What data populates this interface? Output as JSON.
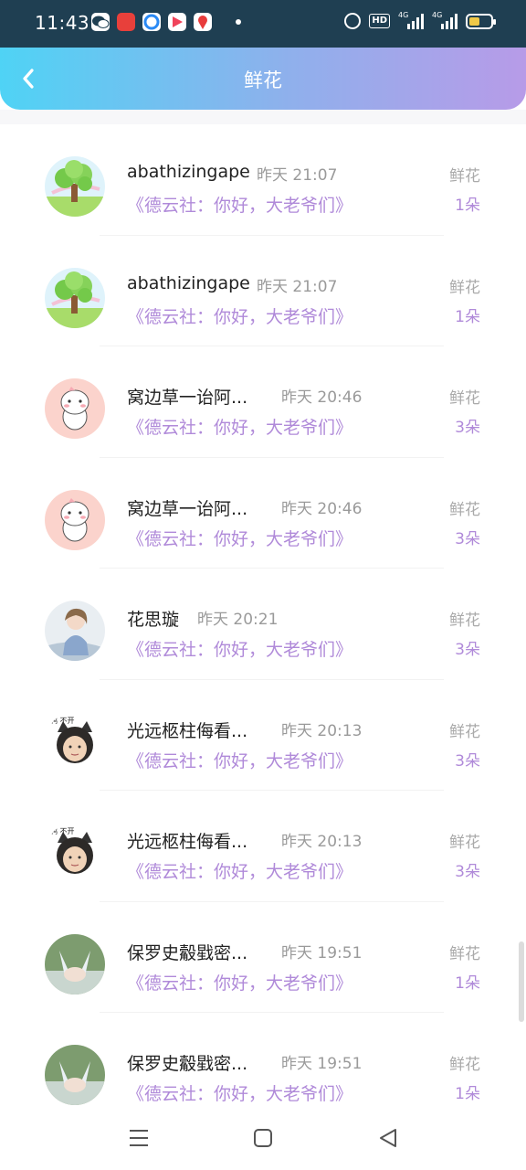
{
  "status_bar": {
    "time": "11:43",
    "network_a": "4G",
    "network_b": "4G",
    "hd": "HD",
    "app_icons": [
      "wechat-icon",
      "toutiao-icon",
      "browser-icon",
      "video-icon",
      "map-icon"
    ]
  },
  "header": {
    "title": "鲜花",
    "back_icon": "chevron-left-icon"
  },
  "rows": [
    {
      "name": "abathizingape",
      "time": "昨天 21:07",
      "program": "《德云社：你好，大老爷们》",
      "gift": "鲜花",
      "count": "1朵",
      "avatar": "tree-avatar"
    },
    {
      "name": "abathizingape",
      "time": "昨天 21:07",
      "program": "《德云社：你好，大老爷们》",
      "gift": "鲜花",
      "count": "1朵",
      "avatar": "tree-avatar"
    },
    {
      "name": "窝边草一诒阿...",
      "time": "昨天 20:46",
      "program": "《德云社：你好，大老爷们》",
      "gift": "鲜花",
      "count": "3朵",
      "avatar": "bunny-avatar"
    },
    {
      "name": "窝边草一诒阿...",
      "time": "昨天 20:46",
      "program": "《德云社：你好，大老爷们》",
      "gift": "鲜花",
      "count": "3朵",
      "avatar": "bunny-avatar"
    },
    {
      "name": "花思璇",
      "time": "昨天 20:21",
      "program": "《德云社：你好，大老爷们》",
      "gift": "鲜花",
      "count": "3朵",
      "avatar": "girl-avatar"
    },
    {
      "name": "光远柩柱侮看...",
      "time": "昨天 20:13",
      "program": "《德云社：你好，大老爷们》",
      "gift": "鲜花",
      "count": "3朵",
      "avatar": "cat-baby-avatar"
    },
    {
      "name": "光远柩柱侮看...",
      "time": "昨天 20:13",
      "program": "《德云社：你好，大老爷们》",
      "gift": "鲜花",
      "count": "3朵",
      "avatar": "cat-baby-avatar"
    },
    {
      "name": "保罗史觳戥密...",
      "time": "昨天 19:51",
      "program": "《德云社：你好，大老爷们》",
      "gift": "鲜花",
      "count": "1朵",
      "avatar": "hands-avatar"
    },
    {
      "name": "保罗史觳戥密...",
      "time": "昨天 19:51",
      "program": "《德云社：你好，大老爷们》",
      "gift": "鲜花",
      "count": "1朵",
      "avatar": "hands-avatar"
    }
  ],
  "nav": {
    "menu_icon": "menu-icon",
    "home_icon": "home-square-icon",
    "back_icon": "back-triangle-icon"
  },
  "colors": {
    "header_start": "#4fd3f5",
    "header_end": "#b79be8",
    "accent_purple": "#b08ad9",
    "status_bar": "#1f3f52"
  }
}
